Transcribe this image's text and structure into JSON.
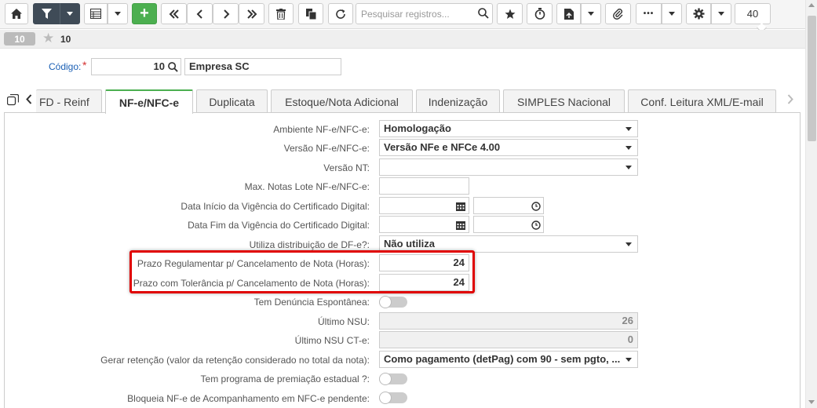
{
  "toolbar": {
    "buttons": [
      {
        "icon": "home-icon"
      },
      {
        "icon": "filter-icon"
      },
      {
        "icon": "grid-icon"
      },
      {
        "icon": "plus-icon",
        "label": "+"
      },
      {
        "icon": "first-icon"
      },
      {
        "icon": "previous-icon"
      },
      {
        "icon": "next-icon"
      },
      {
        "icon": "last-icon"
      },
      {
        "icon": "trash-icon"
      },
      {
        "icon": "copy-icon"
      },
      {
        "icon": "refresh-icon"
      },
      {
        "icon": "star-icon"
      },
      {
        "icon": "timer-icon"
      },
      {
        "icon": "report-icon"
      },
      {
        "icon": "paperclip-icon"
      },
      {
        "icon": "more-icon",
        "label": "•••"
      },
      {
        "icon": "gear-icon"
      }
    ],
    "search_placeholder": "Pesquisar registros...",
    "page_size": "40",
    "colors": {
      "dark_button": "#3f4b57",
      "add_button": "#4caf50"
    }
  },
  "record": {
    "badge": "10",
    "number": "10"
  },
  "header": {
    "codigo_label": "Código:",
    "required_mark": "*",
    "codigo_value": "10",
    "empresa_value": "Empresa SC"
  },
  "tabs": [
    {
      "label": "FD - Reinf",
      "active": false
    },
    {
      "label": "NF-e/NFC-e",
      "active": true
    },
    {
      "label": "Duplicata",
      "active": false
    },
    {
      "label": "Estoque/Nota Adicional",
      "active": false
    },
    {
      "label": "Indenização",
      "active": false
    },
    {
      "label": "SIMPLES Nacional",
      "active": false
    },
    {
      "label": "Conf. Leitura XML/E-mail",
      "active": false
    }
  ],
  "form": {
    "ambiente": {
      "label": "Ambiente NF-e/NFC-e:",
      "value": "Homologação"
    },
    "versao": {
      "label": "Versão NF-e/NFC-e:",
      "value": "Versão NFe e NFCe 4.00"
    },
    "versao_nt": {
      "label": "Versão NT:",
      "value": ""
    },
    "max_notas": {
      "label": "Max. Notas Lote NF-e/NFC-e:",
      "value": ""
    },
    "data_inicio": {
      "label": "Data Início da Vigência do Certificado Digital:"
    },
    "data_fim": {
      "label": "Data Fim da Vigência do Certificado Digital:"
    },
    "distribuicao": {
      "label": "Utiliza distribuição de DF-e?:",
      "value": "Não utiliza"
    },
    "prazo_regulamentar": {
      "label": "Prazo Regulamentar p/ Cancelamento de Nota (Horas):",
      "value": "24"
    },
    "prazo_tolerancia": {
      "label": "Prazo com Tolerância p/ Cancelamento de Nota (Horas):",
      "value": "24"
    },
    "denuncia": {
      "label": "Tem Denúncia Espontânea:",
      "on": false
    },
    "ultimo_nsu": {
      "label": "Último NSU:",
      "value": "26"
    },
    "ultimo_nsu_cte": {
      "label": "Último NSU CT-e:",
      "value": "0"
    },
    "gerar_retencao": {
      "label": "Gerar retenção (valor da retenção considerado no total da nota):",
      "value": "Como pagamento (detPag) com 90 - sem pgto, ..."
    },
    "premiacao": {
      "label": "Tem programa de premiação estadual ?:",
      "on": false
    },
    "bloqueia": {
      "label": "Bloqueia NF-e de Acompanhamento em NFC-e pendente:",
      "on": false
    }
  },
  "highlight_color": "#e00000"
}
